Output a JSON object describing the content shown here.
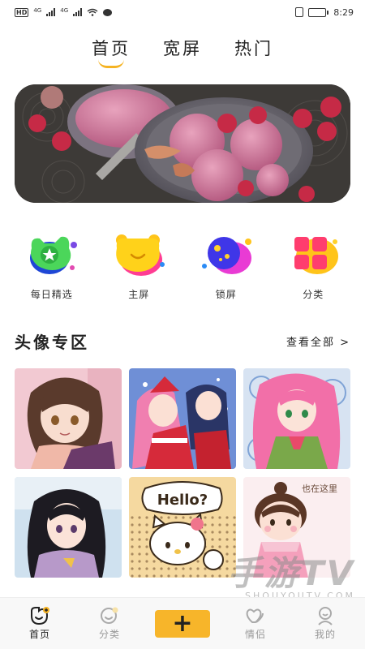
{
  "status_bar": {
    "hd": "HD",
    "net1": "4G",
    "net2": "4G",
    "time": "8:29",
    "battery_level": 0.3,
    "battery_color": "#e9622a"
  },
  "top_tabs": [
    {
      "label": "首页",
      "active": true
    },
    {
      "label": "宽屏",
      "active": false
    },
    {
      "label": "热门",
      "active": false
    }
  ],
  "accent_color": "#f5b323",
  "categories": [
    {
      "label": "每日精选",
      "icon": "star-icon"
    },
    {
      "label": "主屏",
      "icon": "bear-face-icon"
    },
    {
      "label": "锁屏",
      "icon": "planet-icon"
    },
    {
      "label": "分类",
      "icon": "grid-icon"
    }
  ],
  "section": {
    "title": "头像专区",
    "more": "查看全部 >"
  },
  "avatars": [
    {
      "name": "anime-brown-hair-girl"
    },
    {
      "name": "anime-christmas-pink-hair"
    },
    {
      "name": "anime-pink-hair-kimono"
    },
    {
      "name": "anime-black-hair-girl"
    },
    {
      "name": "hello-kitty",
      "caption": "Hello?"
    },
    {
      "name": "cartoon-girl-pink-dress",
      "caption": "也在这里"
    }
  ],
  "watermark": {
    "big": "手游TV",
    "small": "SHOUYOUTV.COM"
  },
  "bottom_nav": [
    {
      "label": "首页",
      "icon": "home-icon",
      "active": true
    },
    {
      "label": "分类",
      "icon": "category-icon",
      "active": false
    },
    {
      "label": "",
      "icon": "plus-icon",
      "add": true
    },
    {
      "label": "情侣",
      "icon": "hearts-icon",
      "active": false
    },
    {
      "label": "我的",
      "icon": "profile-icon",
      "active": false
    }
  ],
  "add_symbol": "+"
}
